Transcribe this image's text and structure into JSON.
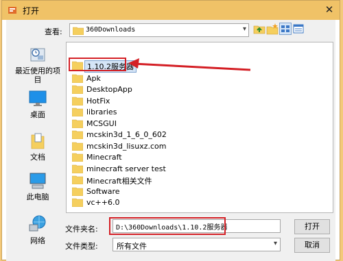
{
  "window": {
    "title": "打开",
    "close_glyph": "✕"
  },
  "toolbar": {
    "look_in_label": "查看:",
    "look_in_value": "360Downloads",
    "buttons": [
      "up-folder-icon",
      "new-folder-icon",
      "list-view-icon",
      "details-view-icon"
    ]
  },
  "places": [
    {
      "label": "最近使用的项目",
      "icon": "recent-items-icon"
    },
    {
      "label": "桌面",
      "icon": "desktop-icon"
    },
    {
      "label": "文档",
      "icon": "documents-icon"
    },
    {
      "label": "此电脑",
      "icon": "computer-icon"
    },
    {
      "label": "网络",
      "icon": "network-icon"
    }
  ],
  "files": [
    {
      "name": "1.10.2服务器",
      "selected": true
    },
    {
      "name": "Apk"
    },
    {
      "name": "DesktopApp"
    },
    {
      "name": "HotFix"
    },
    {
      "name": "libraries"
    },
    {
      "name": "MCSGUI"
    },
    {
      "name": "mcskin3d_1_6_0_602"
    },
    {
      "name": "mcskin3d_lisuxz.com"
    },
    {
      "name": "Minecraft"
    },
    {
      "name": "minecraft server test"
    },
    {
      "name": "Minecraft相关文件"
    },
    {
      "name": "Software"
    },
    {
      "name": "vc++6.0"
    }
  ],
  "form": {
    "filename_label": "文件夹名:",
    "filename_value": "D:\\360Downloads\\1.10.2服务器",
    "filetype_label": "文件类型:",
    "filetype_value": "所有文件",
    "open_button": "打开",
    "cancel_button": "取消"
  },
  "colors": {
    "titlebar": "#f0c267",
    "highlight": "#d41f25",
    "folder": "#f5cf5e"
  }
}
